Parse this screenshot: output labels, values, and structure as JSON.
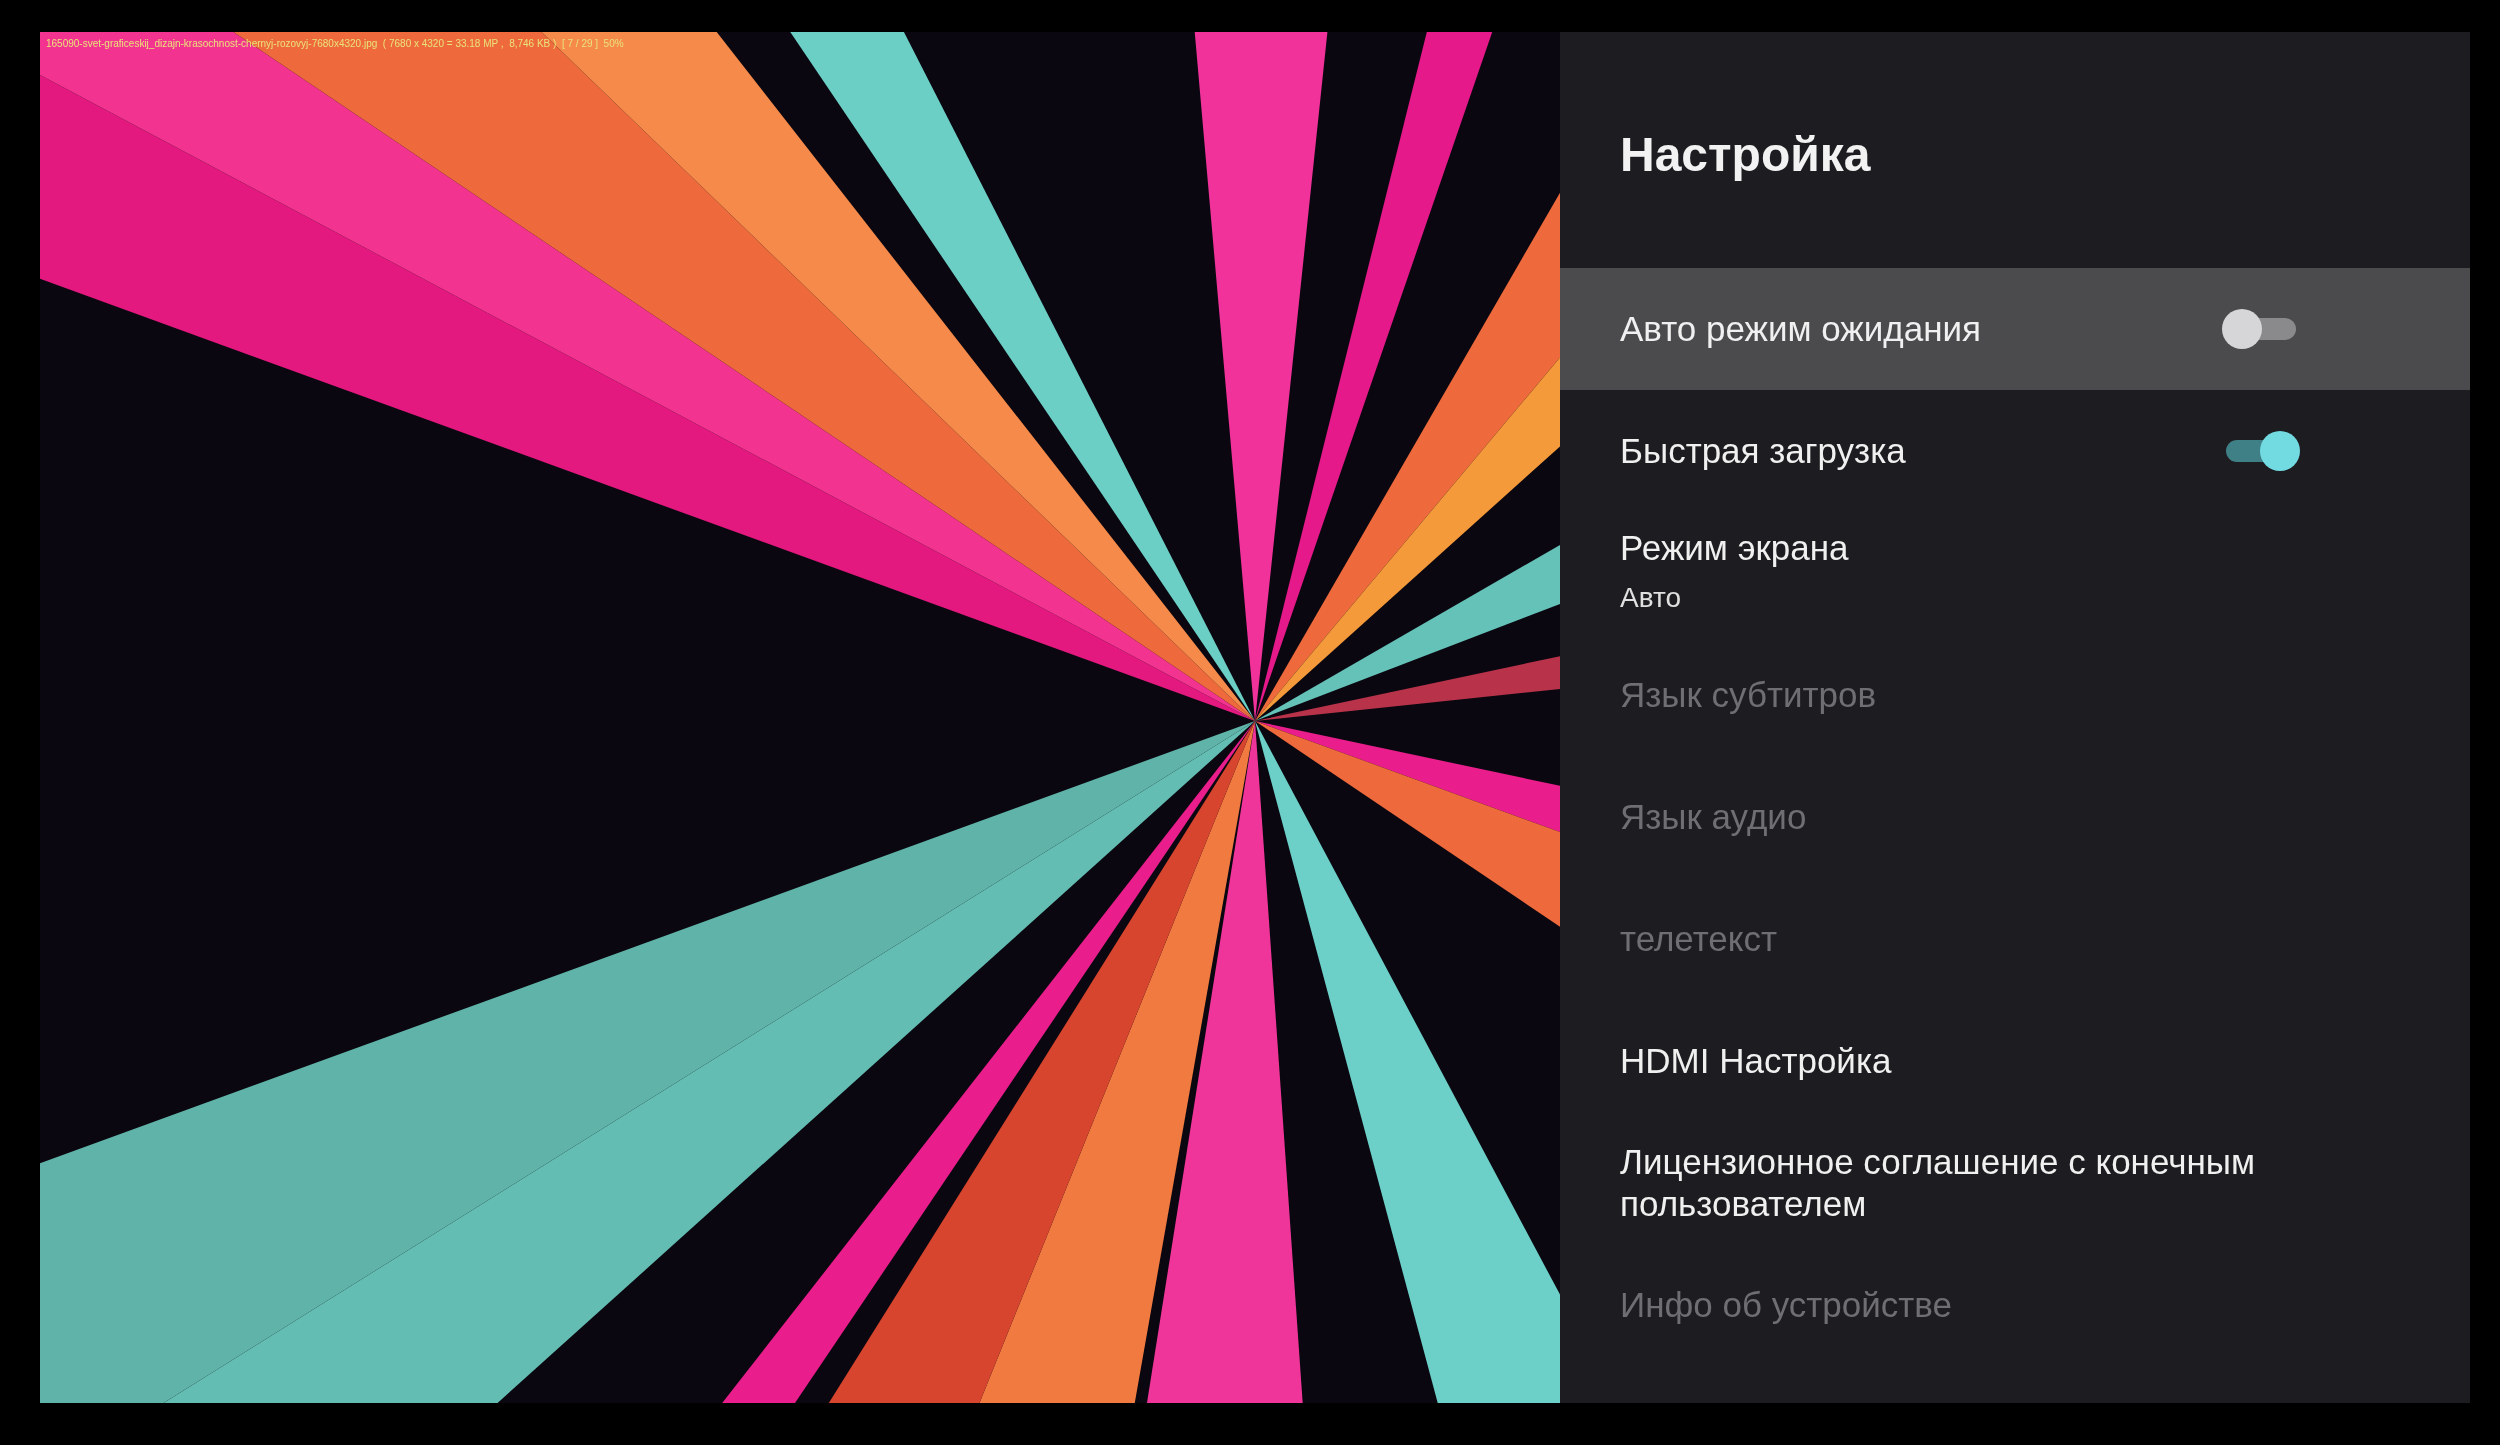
{
  "viewer_caption": "165090-svet-graficeskij_dizajn-krasochnost-chernyj-rozovyj-7680x4320.jpg  ( 7680 x 4320 = 33.18 MP ,  8,746 KB )  [ 7 / 29 ]  50%",
  "settings": {
    "title": "Настройка",
    "items": [
      {
        "kind": "toggle",
        "label": "Авто режим ожидания",
        "on": false,
        "selected": true,
        "disabled": false
      },
      {
        "kind": "toggle",
        "label": "Быстрая загрузка",
        "on": true,
        "selected": false,
        "disabled": false
      },
      {
        "kind": "value",
        "label": "Режим экрана",
        "value": "Авто",
        "selected": false,
        "disabled": false
      },
      {
        "kind": "plain",
        "label": "Язык субтитров",
        "selected": false,
        "disabled": true
      },
      {
        "kind": "plain",
        "label": "Язык аудио",
        "selected": false,
        "disabled": true
      },
      {
        "kind": "plain",
        "label": "телетекст",
        "selected": false,
        "disabled": true
      },
      {
        "kind": "plain",
        "label": "HDMI Настройка",
        "selected": false,
        "disabled": false
      },
      {
        "kind": "plain",
        "label": "Лицензионное соглашение с конечным пользователем",
        "selected": false,
        "disabled": false
      },
      {
        "kind": "plain",
        "label": "Инфо об устройстве",
        "selected": false,
        "disabled": true
      }
    ]
  }
}
